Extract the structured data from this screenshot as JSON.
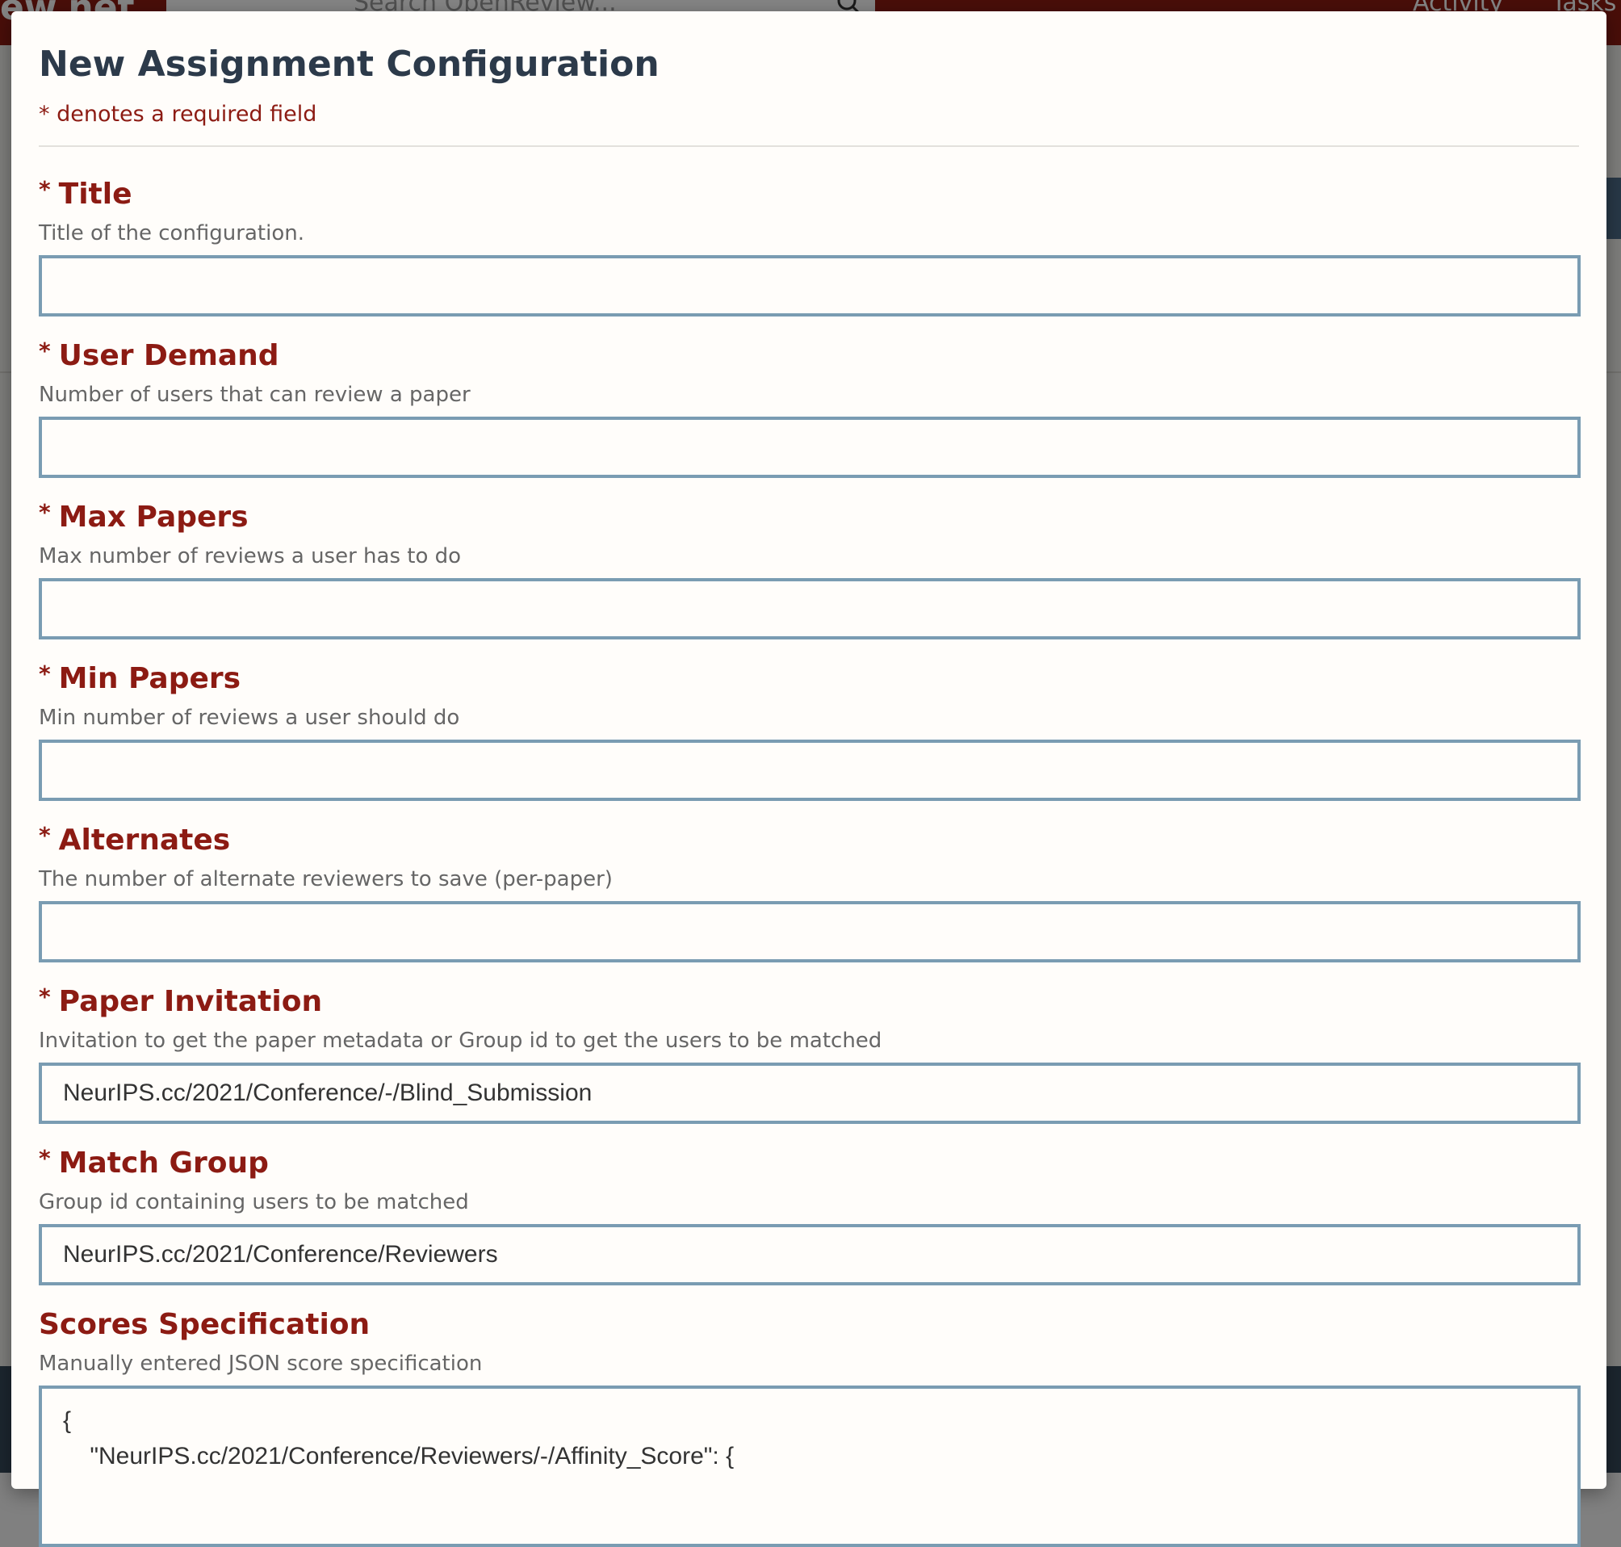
{
  "background": {
    "brand_fragment": "ew.net",
    "search_placeholder": "Search OpenReview...",
    "nav_activity": "Activity",
    "nav_tasks": "Tasks"
  },
  "modal": {
    "title": "New Assignment Configuration",
    "required_note": "* denotes a required field",
    "fields": [
      {
        "label": "Title",
        "required": true,
        "description": "Title of the configuration.",
        "value": "",
        "type": "input"
      },
      {
        "label": "User Demand",
        "required": true,
        "description": "Number of users that can review a paper",
        "value": "",
        "type": "input"
      },
      {
        "label": "Max Papers",
        "required": true,
        "description": "Max number of reviews a user has to do",
        "value": "",
        "type": "input"
      },
      {
        "label": "Min Papers",
        "required": true,
        "description": "Min number of reviews a user should do",
        "value": "",
        "type": "input"
      },
      {
        "label": "Alternates",
        "required": true,
        "description": "The number of alternate reviewers to save (per-paper)",
        "value": "",
        "type": "input"
      },
      {
        "label": "Paper Invitation",
        "required": true,
        "description": "Invitation to get the paper metadata or Group id to get the users to be matched",
        "value": "NeurIPS.cc/2021/Conference/-/Blind_Submission",
        "type": "input"
      },
      {
        "label": "Match Group",
        "required": true,
        "description": "Group id containing users to be matched",
        "value": "NeurIPS.cc/2021/Conference/Reviewers",
        "type": "input"
      },
      {
        "label": "Scores Specification",
        "required": false,
        "description": "Manually entered JSON score specification",
        "value": "{\n    \"NeurIPS.cc/2021/Conference/Reviewers/-/Affinity_Score\": {",
        "type": "textarea"
      }
    ]
  },
  "colors": {
    "accent": "#8c1b13",
    "title": "#2c3a4a",
    "input_border": "#7a9cb2",
    "description": "#666666"
  }
}
